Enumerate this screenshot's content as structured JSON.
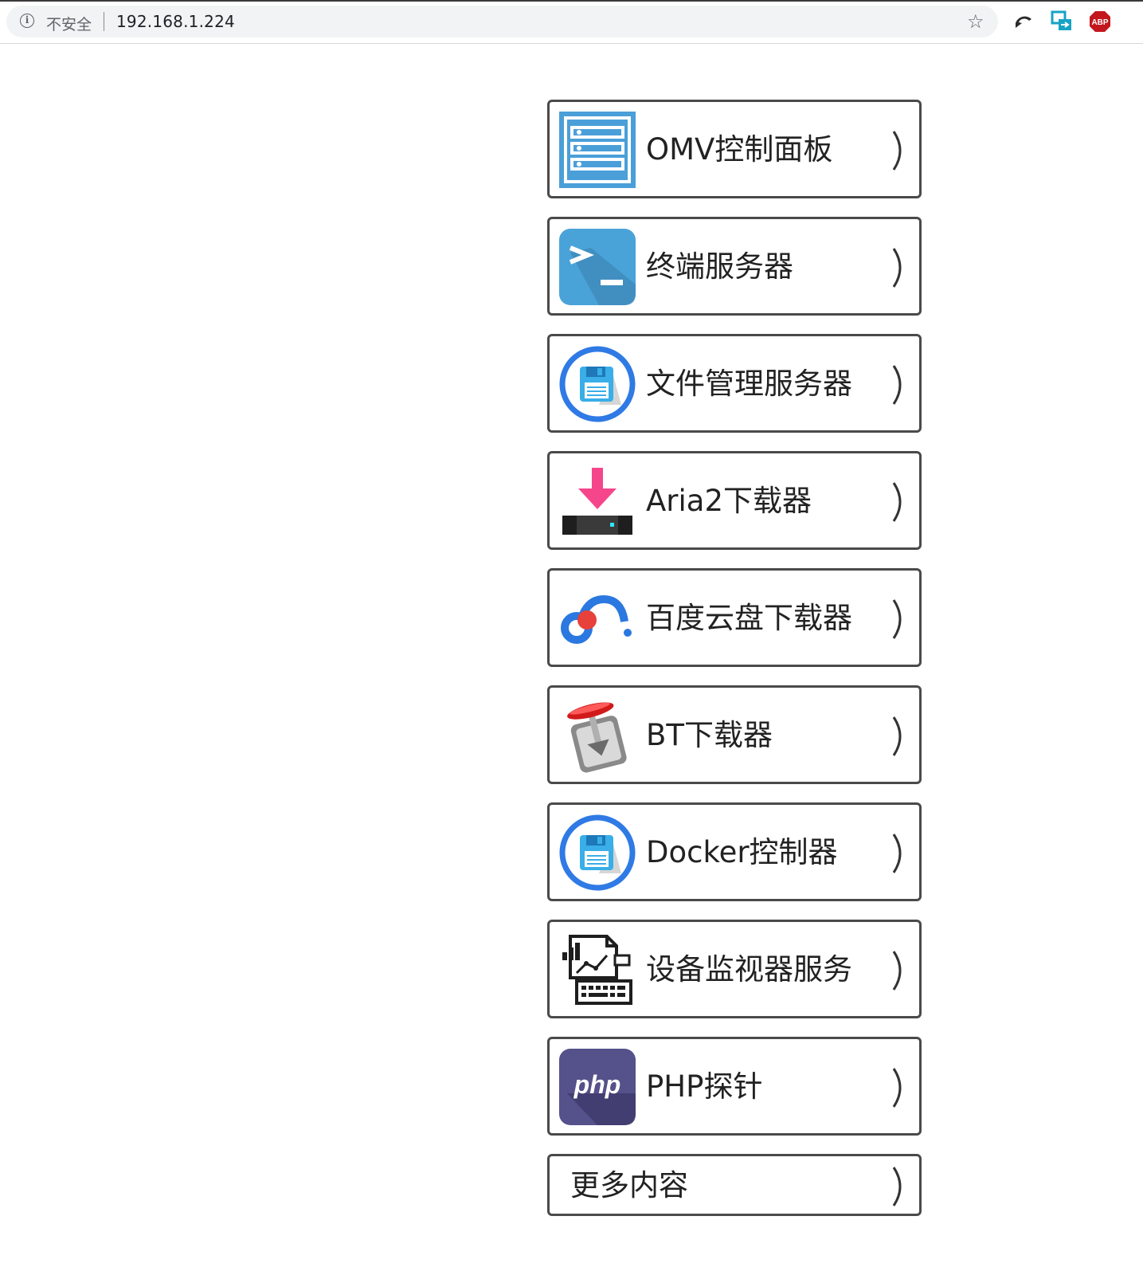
{
  "browser": {
    "security_label": "不安全",
    "url": "192.168.1.224",
    "info_glyph": "i",
    "star_glyph": "☆",
    "extensions": [
      {
        "name": "back-arrow-extension-icon"
      },
      {
        "name": "translate-extension-icon"
      },
      {
        "name": "adblock-plus-extension-icon",
        "text": "ABP"
      }
    ]
  },
  "menu": {
    "items": [
      {
        "label": "OMV控制面板",
        "icon": "server-panel-icon"
      },
      {
        "label": "终端服务器",
        "icon": "terminal-icon"
      },
      {
        "label": "文件管理服务器",
        "icon": "floppy-disk-icon"
      },
      {
        "label": "Aria2下载器",
        "icon": "download-arrow-icon"
      },
      {
        "label": "百度云盘下载器",
        "icon": "baidu-cloud-icon"
      },
      {
        "label": "BT下载器",
        "icon": "transmission-icon"
      },
      {
        "label": "Docker控制器",
        "icon": "floppy-disk-icon"
      },
      {
        "label": "设备监视器服务",
        "icon": "device-monitor-icon"
      },
      {
        "label": "PHP探针",
        "icon": "php-icon",
        "icon_text": "php"
      },
      {
        "label": "更多内容",
        "icon": ""
      }
    ]
  },
  "colors": {
    "border": "#4a4a4a",
    "omv_blue": "#4a9fd9",
    "terminal_blue": "#4aa3d8",
    "disk_ring": "#2f7ae5",
    "aria_pink": "#f5468c",
    "php_purple": "#55518a",
    "abp_red": "#c3171e"
  }
}
